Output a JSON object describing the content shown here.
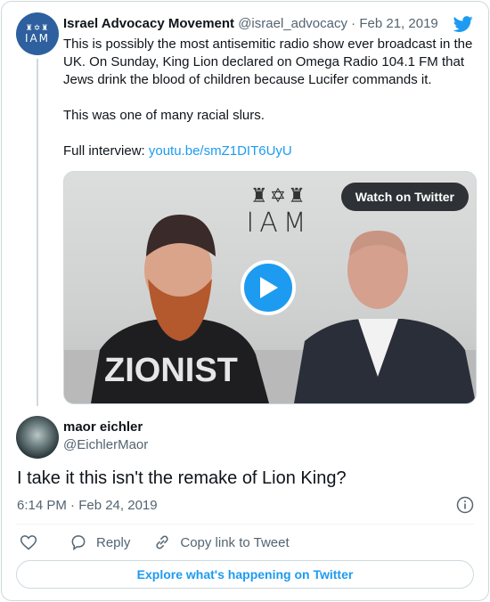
{
  "tweet": {
    "author_name": "Israel Advocacy Movement",
    "author_handle": "@israel_advocacy",
    "separator": " · ",
    "date": "Feb 21, 2019",
    "avatar_text": "IAM",
    "paragraph1": "This is possibly the most antisemitic radio show ever broadcast in the UK. On Sunday, King Lion declared on Omega Radio 104.1 FM that Jews drink the blood of children because Lucifer commands it.",
    "paragraph2": "This was one of many racial slurs.",
    "interview_prefix": "Full interview: ",
    "interview_link": "youtu.be/smZ1DIT6UyU",
    "video": {
      "watch_label": "Watch on Twitter",
      "logo_text": "IAM",
      "shirt_text": "ZIONIST"
    }
  },
  "reply": {
    "author_name": "maor eichler",
    "author_handle": "@EichlerMaor",
    "text": "I take it this isn't the remake of Lion King?",
    "timestamp": "6:14 PM · Feb 24, 2019"
  },
  "actions": {
    "reply_label": "Reply",
    "copy_label": "Copy link to Tweet"
  },
  "explore_label": "Explore what's happening on Twitter",
  "colors": {
    "accent": "#1d9bf0",
    "text": "#0f1419",
    "muted": "#536471",
    "border": "#cfd9de"
  }
}
